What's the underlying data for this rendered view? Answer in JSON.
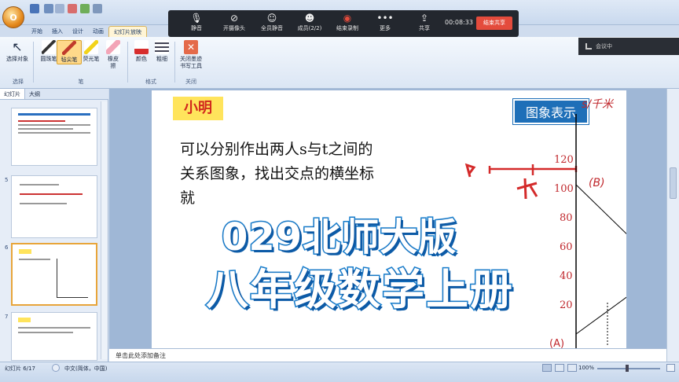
{
  "app": {
    "office_button": "O"
  },
  "tabs": [
    "开始",
    "插入",
    "设计",
    "动画",
    "幻灯片放映"
  ],
  "meeting": {
    "items": [
      {
        "icon": "microphone-icon",
        "label": "静音"
      },
      {
        "icon": "camera-off-icon",
        "label": "开摄像头"
      },
      {
        "icon": "users-mute-icon",
        "label": "全员静音"
      },
      {
        "icon": "members-icon",
        "label": "成员(2/2)"
      },
      {
        "icon": "record-icon",
        "label": "结束录制"
      },
      {
        "icon": "more-icon",
        "label": "更多"
      },
      {
        "icon": "share-icon",
        "label": "共享"
      }
    ],
    "time": "00:08:33",
    "stop_share": "结束共享",
    "status": "会议中"
  },
  "ribbon": {
    "buttons": [
      {
        "label": "选择对象",
        "icon": "cursor-icon"
      },
      {
        "label": "圆珠笔",
        "icon": "pen-icon"
      },
      {
        "label": "毡尖笔",
        "icon": "felt-pen-icon"
      },
      {
        "label": "荧光笔",
        "icon": "highlighter-icon"
      },
      {
        "label": "橡皮擦",
        "icon": "eraser-icon"
      },
      {
        "label": "颜色",
        "icon": "color-icon"
      },
      {
        "label": "粗细",
        "icon": "thickness-icon"
      },
      {
        "label": "关闭墨迹书写工具",
        "icon": "close-ink-icon"
      }
    ],
    "groups": [
      "选择",
      "笔",
      "格式",
      "关闭"
    ]
  },
  "left_panel": {
    "tabs": [
      "幻灯片",
      "大纲"
    ],
    "thumbnails": [
      "",
      "5",
      "6",
      "7"
    ]
  },
  "slide": {
    "tag": "小明",
    "body": "可以分别作出两人s与t之间的关系图象，找出交点的横坐标就",
    "graph_label": "图象表示",
    "y_axis_label": "s/千米",
    "y_ticks": [
      "120",
      "100",
      "80",
      "60",
      "40",
      "20"
    ],
    "point_b": "(B)",
    "line_jia": "甲",
    "line_yi": "乙",
    "origin": "(A)"
  },
  "notes_placeholder": "单击此处添加备注",
  "status": {
    "slide_info": "幻灯片 6/17",
    "language": "中文(简体，中国)",
    "zoom": "100%"
  },
  "watermark": {
    "line1": "029北师大版",
    "line2": "八年级数学上册"
  }
}
